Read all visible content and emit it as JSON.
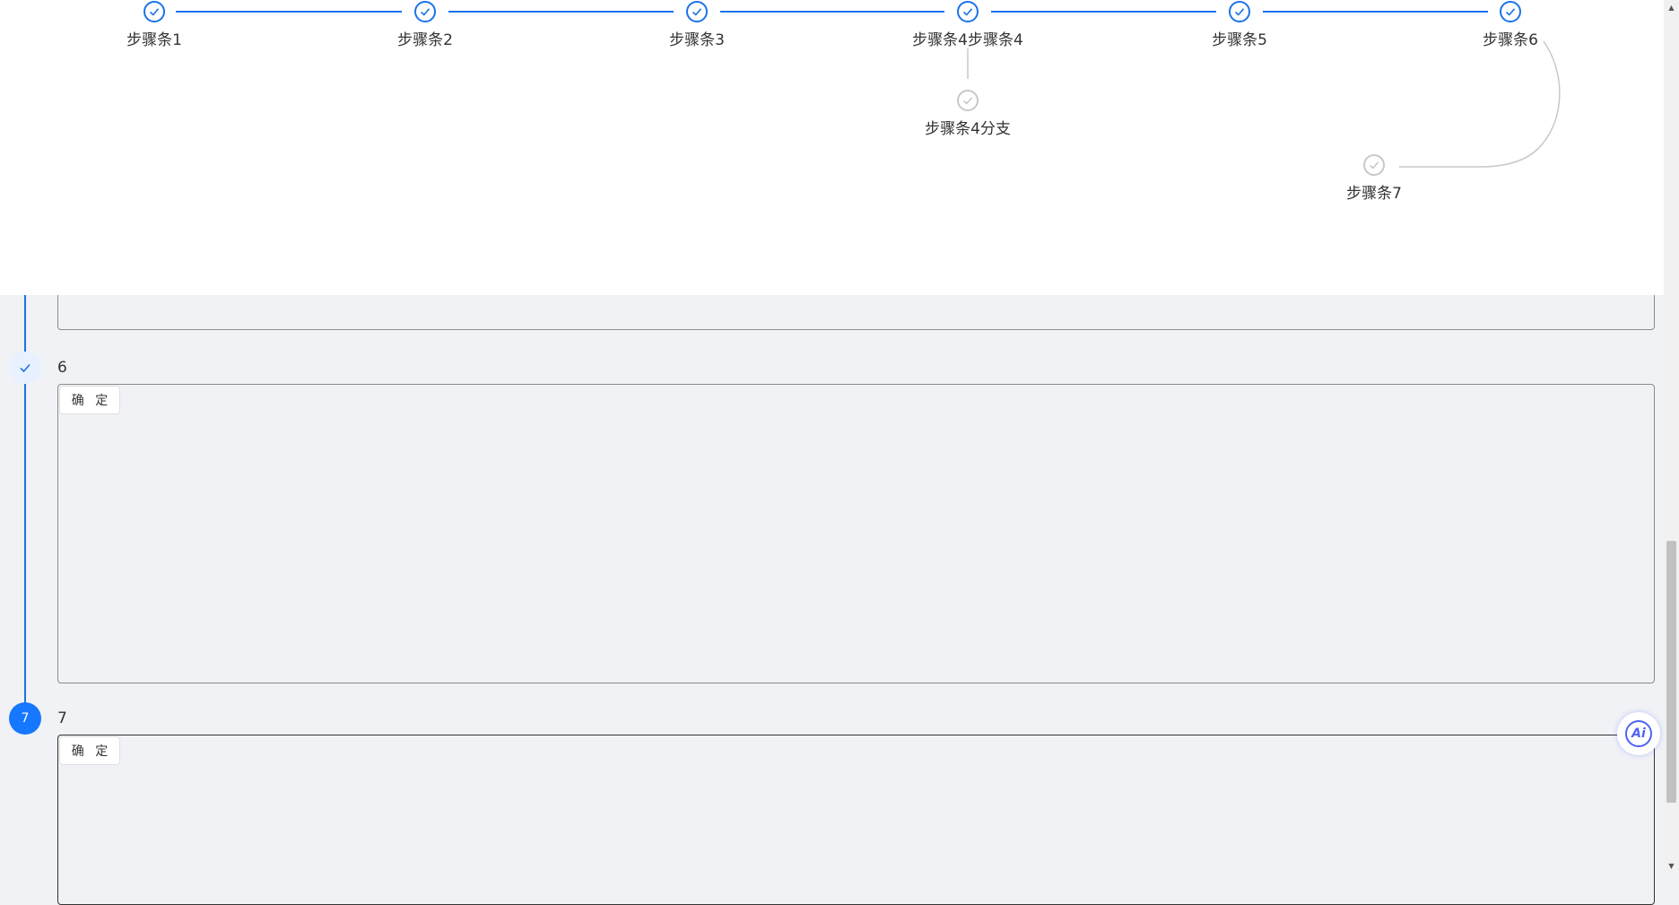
{
  "top_steps": {
    "main": [
      {
        "label": "步骤条1",
        "status": "done"
      },
      {
        "label": "步骤条2",
        "status": "done"
      },
      {
        "label": "步骤条3",
        "status": "done"
      },
      {
        "label": "步骤条4步骤条4",
        "status": "done"
      },
      {
        "label": "步骤条5",
        "status": "done"
      },
      {
        "label": "步骤条6",
        "status": "done"
      }
    ],
    "branch_4": {
      "label": "步骤条4分支",
      "status": "pending"
    },
    "branch_6": {
      "label": "步骤条7",
      "status": "pending"
    }
  },
  "timeline": {
    "steps": [
      {
        "title": "6",
        "button_label": "确 定",
        "status": "done"
      },
      {
        "title": "7",
        "button_label": "确 定",
        "status": "active",
        "number": "7"
      }
    ]
  },
  "ai_button": {
    "label": "Ai",
    "icon": "ai-assistant-icon"
  },
  "colors": {
    "accent": "#1a73e8",
    "active_node": "#1677ff",
    "done_node_bg": "#e8f1ff",
    "pending": "#c8c8c8",
    "background": "#f0f2f5"
  }
}
